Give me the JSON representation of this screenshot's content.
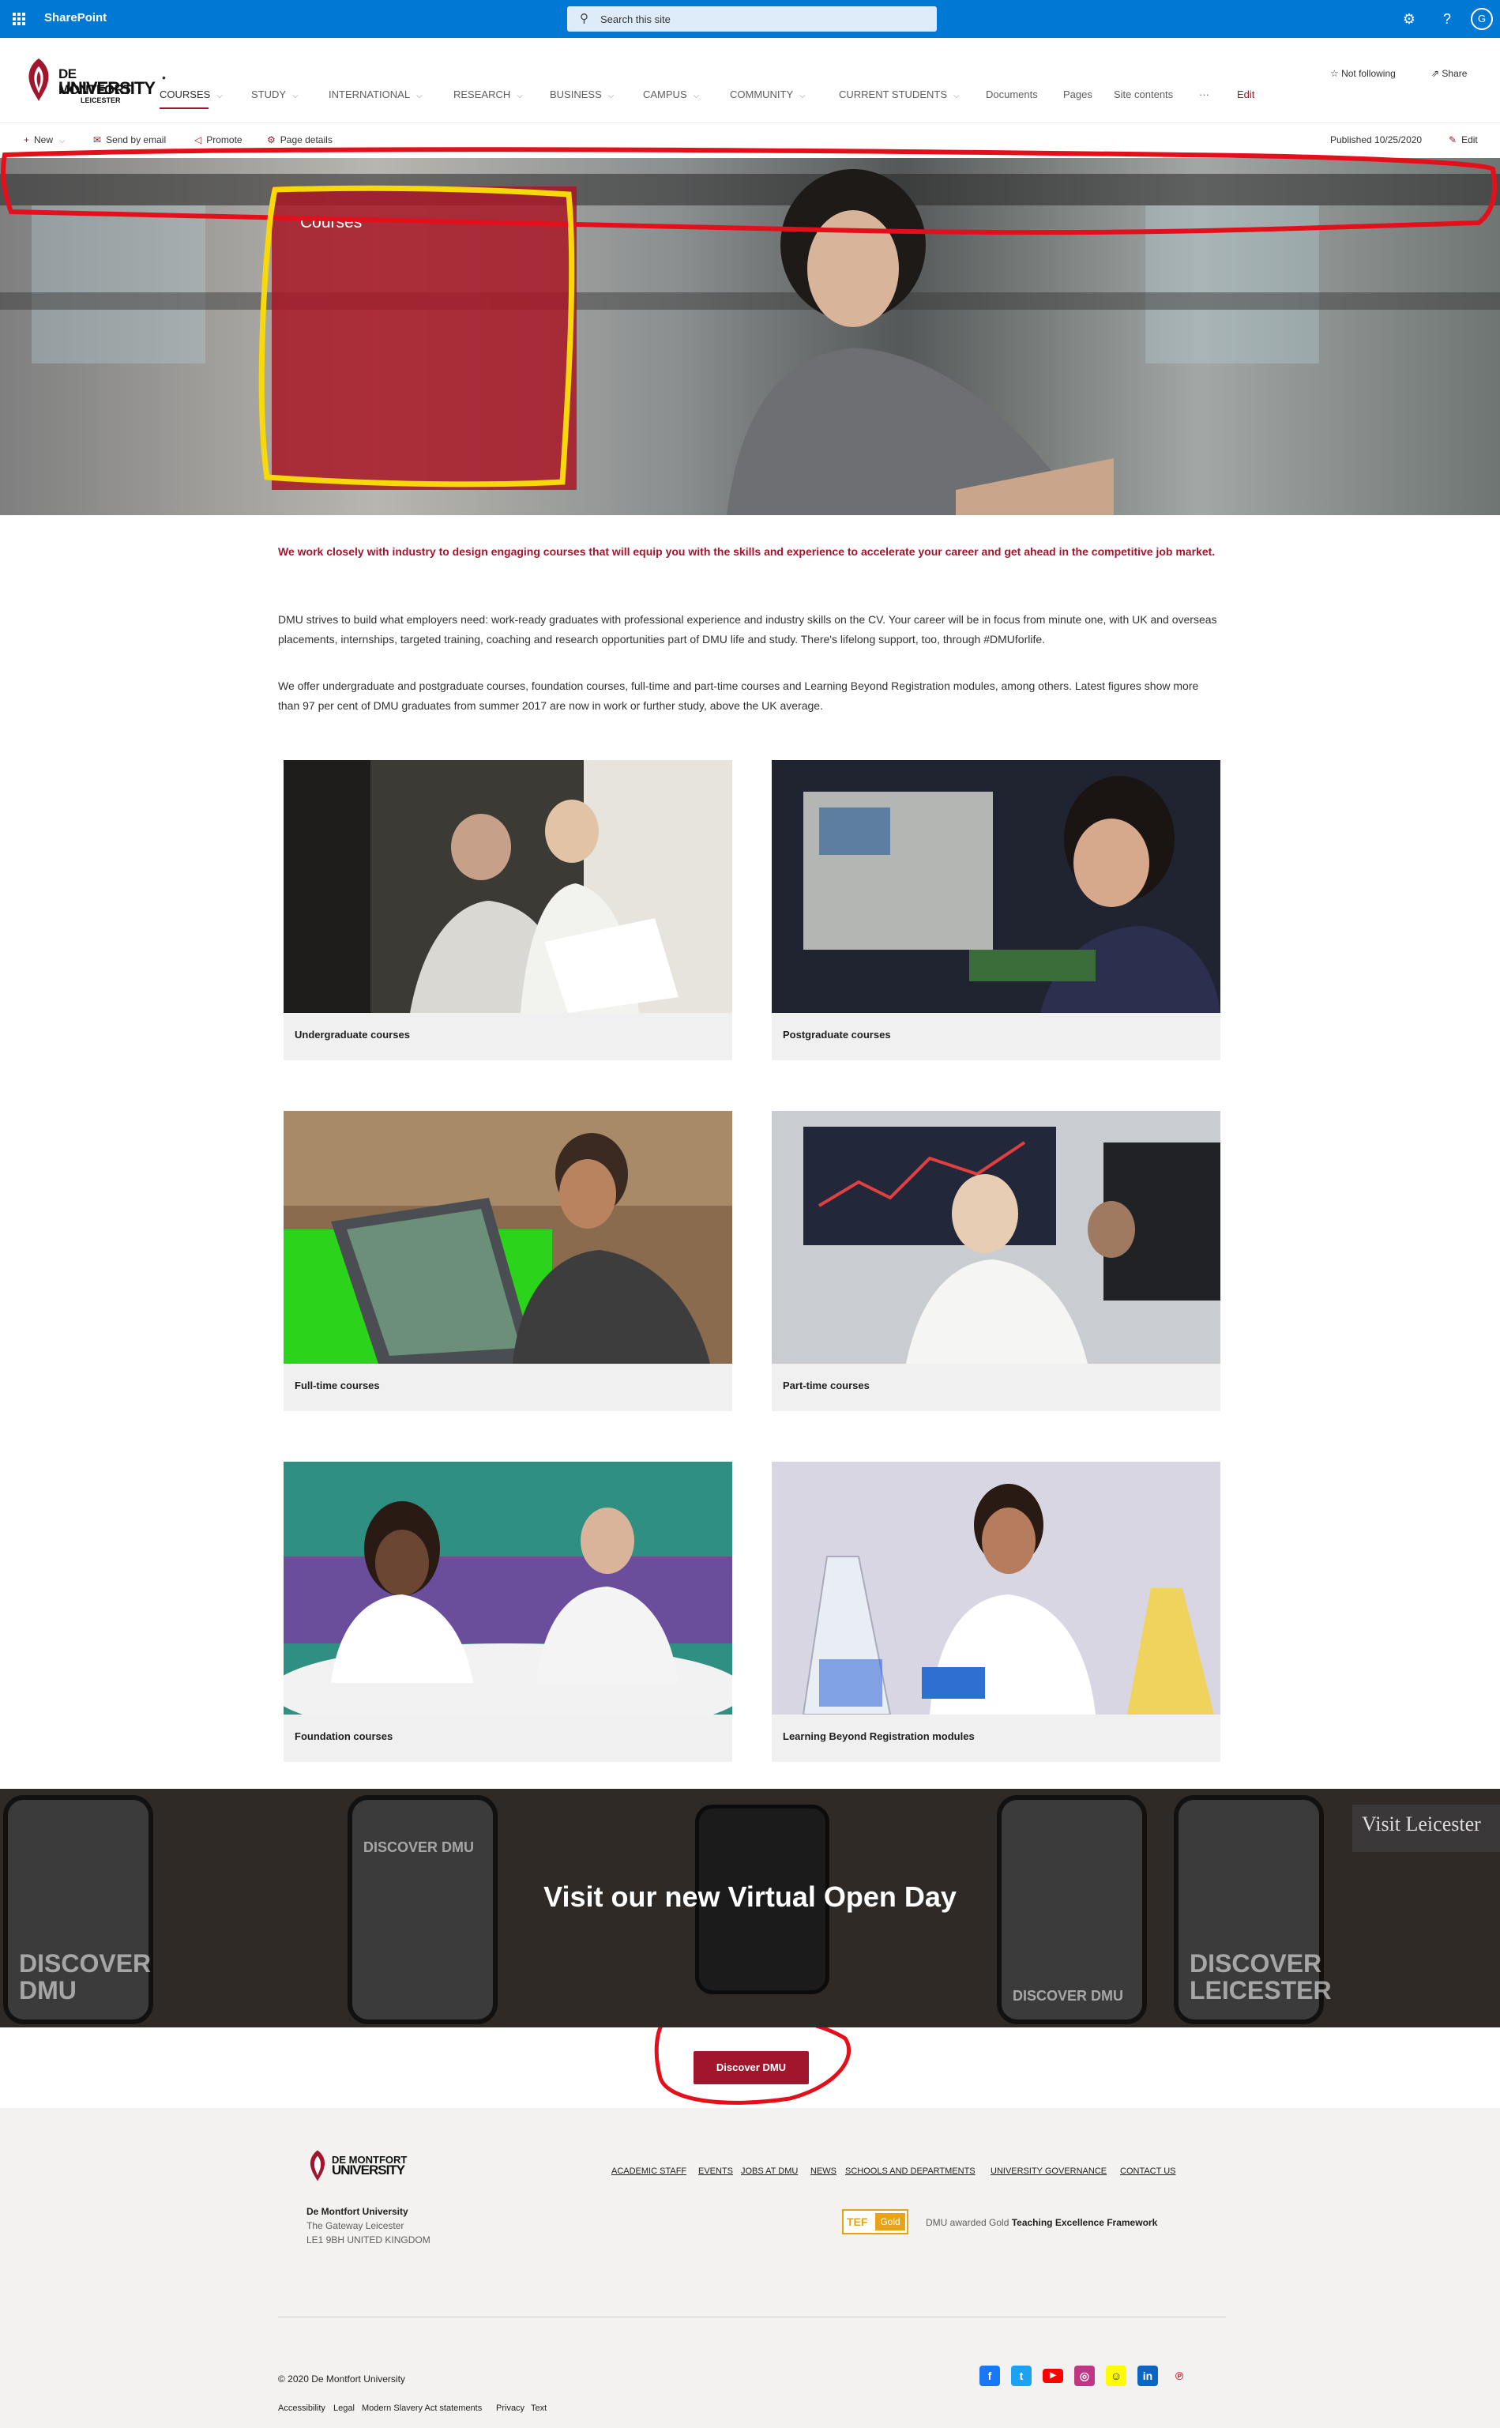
{
  "suite": {
    "app_name": "SharePoint",
    "search_placeholder": "Search this site",
    "avatar_initial": "G",
    "settings_icon": "gear-icon",
    "help_icon": "question-icon"
  },
  "site": {
    "logo": {
      "line1": "DE MONTFORT",
      "line2": "UNIVERSITY",
      "line3": "LEICESTER"
    },
    "nav": [
      {
        "label": "COURSES",
        "has_menu": true,
        "active": true
      },
      {
        "label": "STUDY",
        "has_menu": true
      },
      {
        "label": "INTERNATIONAL",
        "has_menu": true
      },
      {
        "label": "RESEARCH",
        "has_menu": true
      },
      {
        "label": "BUSINESS",
        "has_menu": true
      },
      {
        "label": "CAMPUS",
        "has_menu": true
      },
      {
        "label": "COMMUNITY",
        "has_menu": true
      },
      {
        "label": "CURRENT STUDENTS",
        "has_menu": true
      },
      {
        "label": "Documents"
      },
      {
        "label": "Pages"
      },
      {
        "label": "Site contents"
      },
      {
        "label": "···"
      },
      {
        "label": "Edit"
      }
    ],
    "not_following": "Not following",
    "share": "Share"
  },
  "commandbar": {
    "new": "New",
    "send_by_email": "Send by email",
    "promote": "Promote",
    "page_details": "Page details",
    "published": "Published 10/25/2020",
    "edit": "Edit"
  },
  "hero": {
    "title": "Courses"
  },
  "content": {
    "lead": "We work closely with industry to design engaging courses that will equip you with the skills and experience to accelerate your career and get ahead in the competitive job market.",
    "para1": "DMU strives to build what employers need: work-ready graduates with professional experience and industry skills on the CV. Your career will be in focus from minute one, with UK and overseas placements, internships, targeted training, coaching and research opportunities part of DMU life and study. There's lifelong support, too, through #DMUforlife.",
    "para2": "We offer undergraduate and postgraduate courses, foundation courses, full-time and part-time courses and Learning Beyond Registration modules, among others. Latest figures show more than 97 per cent of DMU graduates from summer 2017 are now in work or further study, above the UK average."
  },
  "cards": [
    {
      "label": "Undergraduate courses"
    },
    {
      "label": "Postgraduate courses"
    },
    {
      "label": "Full-time courses"
    },
    {
      "label": "Part-time courses"
    },
    {
      "label": "Foundation courses"
    },
    {
      "label": "Learning Beyond Registration modules"
    }
  ],
  "banner": {
    "headline": "Visit our new Virtual Open Day",
    "phone_texts": [
      "DISCOVER DMU",
      "DISCOVER DMU",
      "DISCOVER DMU",
      "DISCOVER LEICESTER"
    ],
    "sign_text": "Visit Leicester",
    "cta": "Discover DMU"
  },
  "footer": {
    "logo": {
      "line1": "DE MONTFORT",
      "line2": "UNIVERSITY"
    },
    "address_name": "De Montfort University",
    "address_line1": "The Gateway  Leicester",
    "address_line2": "LE1 9BH  UNITED KINGDOM",
    "links": [
      "ACADEMIC STAFF",
      "EVENTS",
      "JOBS AT DMU",
      "NEWS",
      "SCHOOLS AND DEPARTMENTS",
      "UNIVERSITY GOVERNANCE",
      "CONTACT US"
    ],
    "tef_badge": {
      "left": "TEF",
      "right": "Gold"
    },
    "tef_note_prefix": "DMU awarded Gold",
    "tef_note_bold": "Teaching Excellence Framework",
    "copyright": "© 2020 De Montfort University",
    "legal_links": [
      "Accessibility",
      "Legal",
      "Modern Slavery Act statements",
      "Privacy",
      "Text"
    ],
    "social": [
      "facebook-icon",
      "twitter-icon",
      "youtube-icon",
      "instagram-icon",
      "snapchat-icon",
      "linkedin-icon",
      "pinterest-icon"
    ]
  },
  "colors": {
    "suite_blue": "#0078d4",
    "brand_red": "#a1152d",
    "annotation_red": "#e3101c",
    "annotation_yellow": "#f6d80b"
  }
}
